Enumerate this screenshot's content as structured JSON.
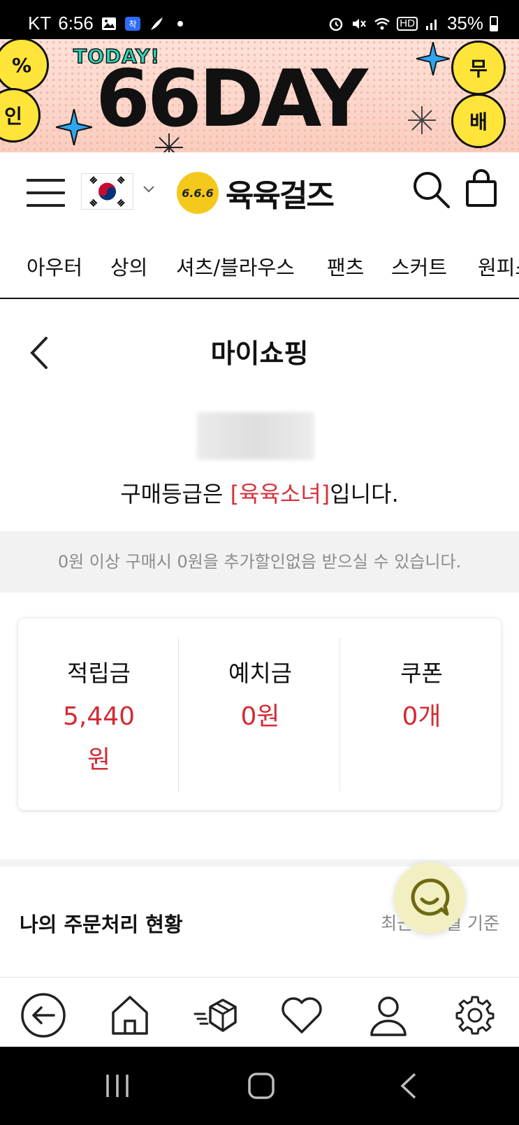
{
  "status_bar": {
    "carrier": "KT",
    "time": "6:56",
    "hd_label": "HD",
    "battery": "35%"
  },
  "banner": {
    "today_text": "TODAY!",
    "title": "66DAY",
    "left_circle_top": "%",
    "left_circle_bottom": "인",
    "right_circle_top": "무",
    "right_circle_bottom": "배"
  },
  "header": {
    "logo_mark": "6.6.6",
    "logo_text": "육육걸즈"
  },
  "categories": [
    "아우터",
    "상의",
    "셔츠/블라우스",
    "팬츠",
    "스커트",
    "원피스"
  ],
  "page": {
    "title": "마이쇼핑",
    "grade_prefix": "구매등급은 ",
    "grade_name": "[육육소녀]",
    "grade_suffix": "입니다.",
    "notice": "0원 이상 구매시 0원을 추가할인없음 받으실 수 있습니다."
  },
  "balance": {
    "points_label": "적립금",
    "points_value": "5,440",
    "points_unit": "원",
    "deposit_label": "예치금",
    "deposit_value": "0원",
    "coupon_label": "쿠폰",
    "coupon_value": "0개"
  },
  "orders": {
    "title": "나의 주문처리 현황",
    "note": "최근 3개월 기준"
  },
  "colors": {
    "accent_red": "#d32b34",
    "banner_yellow": "#ffe43a",
    "logo_yellow": "#f5c91c",
    "chat_bg": "#f2f0c2"
  }
}
